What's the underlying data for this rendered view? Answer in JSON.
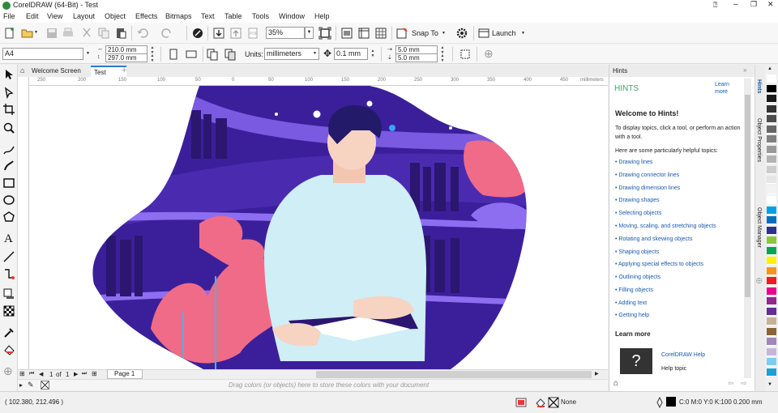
{
  "app": {
    "title": "CorelDRAW (64-Bit) - Test"
  },
  "window": {
    "minimize": "–",
    "restore": "❐",
    "close": "✕",
    "help": "⍰"
  },
  "menu": [
    "File",
    "Edit",
    "View",
    "Layout",
    "Object",
    "Effects",
    "Bitmaps",
    "Text",
    "Table",
    "Tools",
    "Window",
    "Help"
  ],
  "toolbar": {
    "zoom": "35%",
    "snap_to": "Snap To",
    "launch": "Launch"
  },
  "propbar": {
    "page_size": "A4",
    "width": "210.0 mm",
    "height": "297.0 mm",
    "units_label": "Units:",
    "units": "millimeters",
    "nudge": "0.1 mm",
    "dup_x": "5.0 mm",
    "dup_y": "5.0 mm"
  },
  "tabs": {
    "welcome": "Welcome Screen",
    "doc": "Test",
    "add": "+"
  },
  "ruler": {
    "ticks": [
      "250",
      "200",
      "150",
      "100",
      "50",
      "0",
      "50",
      "100",
      "150",
      "200",
      "250",
      "300",
      "350",
      "400",
      "450",
      "500"
    ],
    "unit": "millimeters"
  },
  "docnav": {
    "page_current": "1",
    "of_label": "of",
    "page_total": "1",
    "page_tab": "Page 1"
  },
  "palette_hint": "Drag colors (or objects) here to store these colors with your document",
  "status": {
    "coords": "( 102.380, 212.496 )",
    "fill": "None",
    "outline": "C:0 M:0 Y:0 K:100  0.200 mm"
  },
  "hints": {
    "panel_title": "Hints",
    "heading": "HINTS",
    "learn_more_top": "Learn more",
    "welcome": "Welcome to Hints!",
    "p1": "To display topics, click a tool, or perform an action with a tool.",
    "p2": "Here are some particularly helpful topics:",
    "links": [
      "Drawing lines",
      "Drawing connector lines",
      "Drawing dimension lines",
      "Drawing shapes",
      "Selecting objects",
      "Moving, scaling, and stretching objects",
      "Rotating and skewing objects",
      "Shaping objects",
      "Applying special effects to objects",
      "Outlining objects",
      "Filling objects",
      "Adding text",
      "Getting help"
    ],
    "learn_more": "Learn more",
    "help_title": "CorelDRAW Help",
    "help_topic": "Help topic"
  },
  "dock_tabs": [
    "Hints",
    "Object Properties",
    "Object Manager"
  ],
  "colors": {
    "accent": "#3aa56b",
    "link": "#1a5aa8",
    "purple": "#4b2aa8",
    "pink": "#f07090"
  },
  "palette_colors": [
    "#ffffff",
    "#000000",
    "#1a1a1a",
    "#333333",
    "#4d4d4d",
    "#666666",
    "#808080",
    "#999999",
    "#b3b3b3",
    "#cccccc",
    "#e6e6e6",
    "#f2f2f2",
    "#ffffff",
    "#00a0e9",
    "#0070c0",
    "#2e3192",
    "#8cc63f",
    "#00a651",
    "#fff200",
    "#f7941d",
    "#ed1c24",
    "#ec008c",
    "#92278f",
    "#662d91",
    "#c7b299",
    "#8c6239",
    "#a186be",
    "#c6b5d9",
    "#7ecdf0",
    "#1ba1d8"
  ]
}
